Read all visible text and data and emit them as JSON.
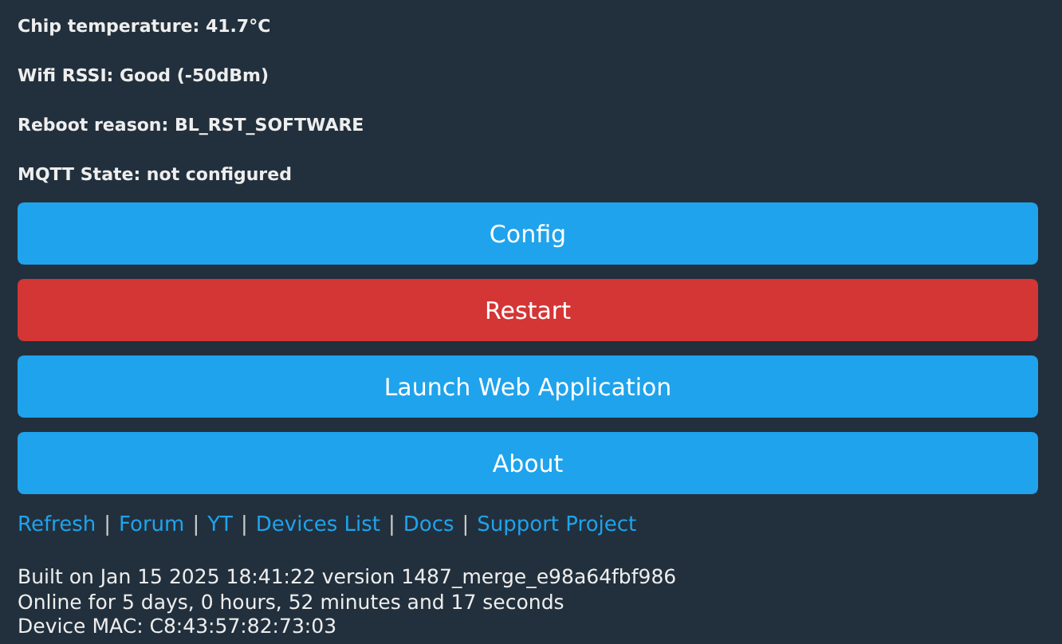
{
  "info_lines": [
    "Chip temperature: 41.7°C",
    "Wifi RSSI: Good (-50dBm)",
    "Reboot reason: BL_RST_SOFTWARE",
    "MQTT State: not configured"
  ],
  "buttons": [
    {
      "label": "Config",
      "kind": "primary"
    },
    {
      "label": "Restart",
      "kind": "danger"
    },
    {
      "label": "Launch Web Application",
      "kind": "primary"
    },
    {
      "label": "About",
      "kind": "primary"
    }
  ],
  "links": [
    {
      "label": "Refresh"
    },
    {
      "label": "Forum"
    },
    {
      "label": "YT"
    },
    {
      "label": "Devices List"
    },
    {
      "label": "Docs"
    },
    {
      "label": "Support Project"
    }
  ],
  "separator": "|",
  "footer_lines": [
    "Built on Jan 15 2025 18:41:22 version 1487_merge_e98a64fbf986",
    "Online for 5 days, 0 hours, 52 minutes and 17 seconds",
    "Device MAC: C8:43:57:82:73:03"
  ]
}
